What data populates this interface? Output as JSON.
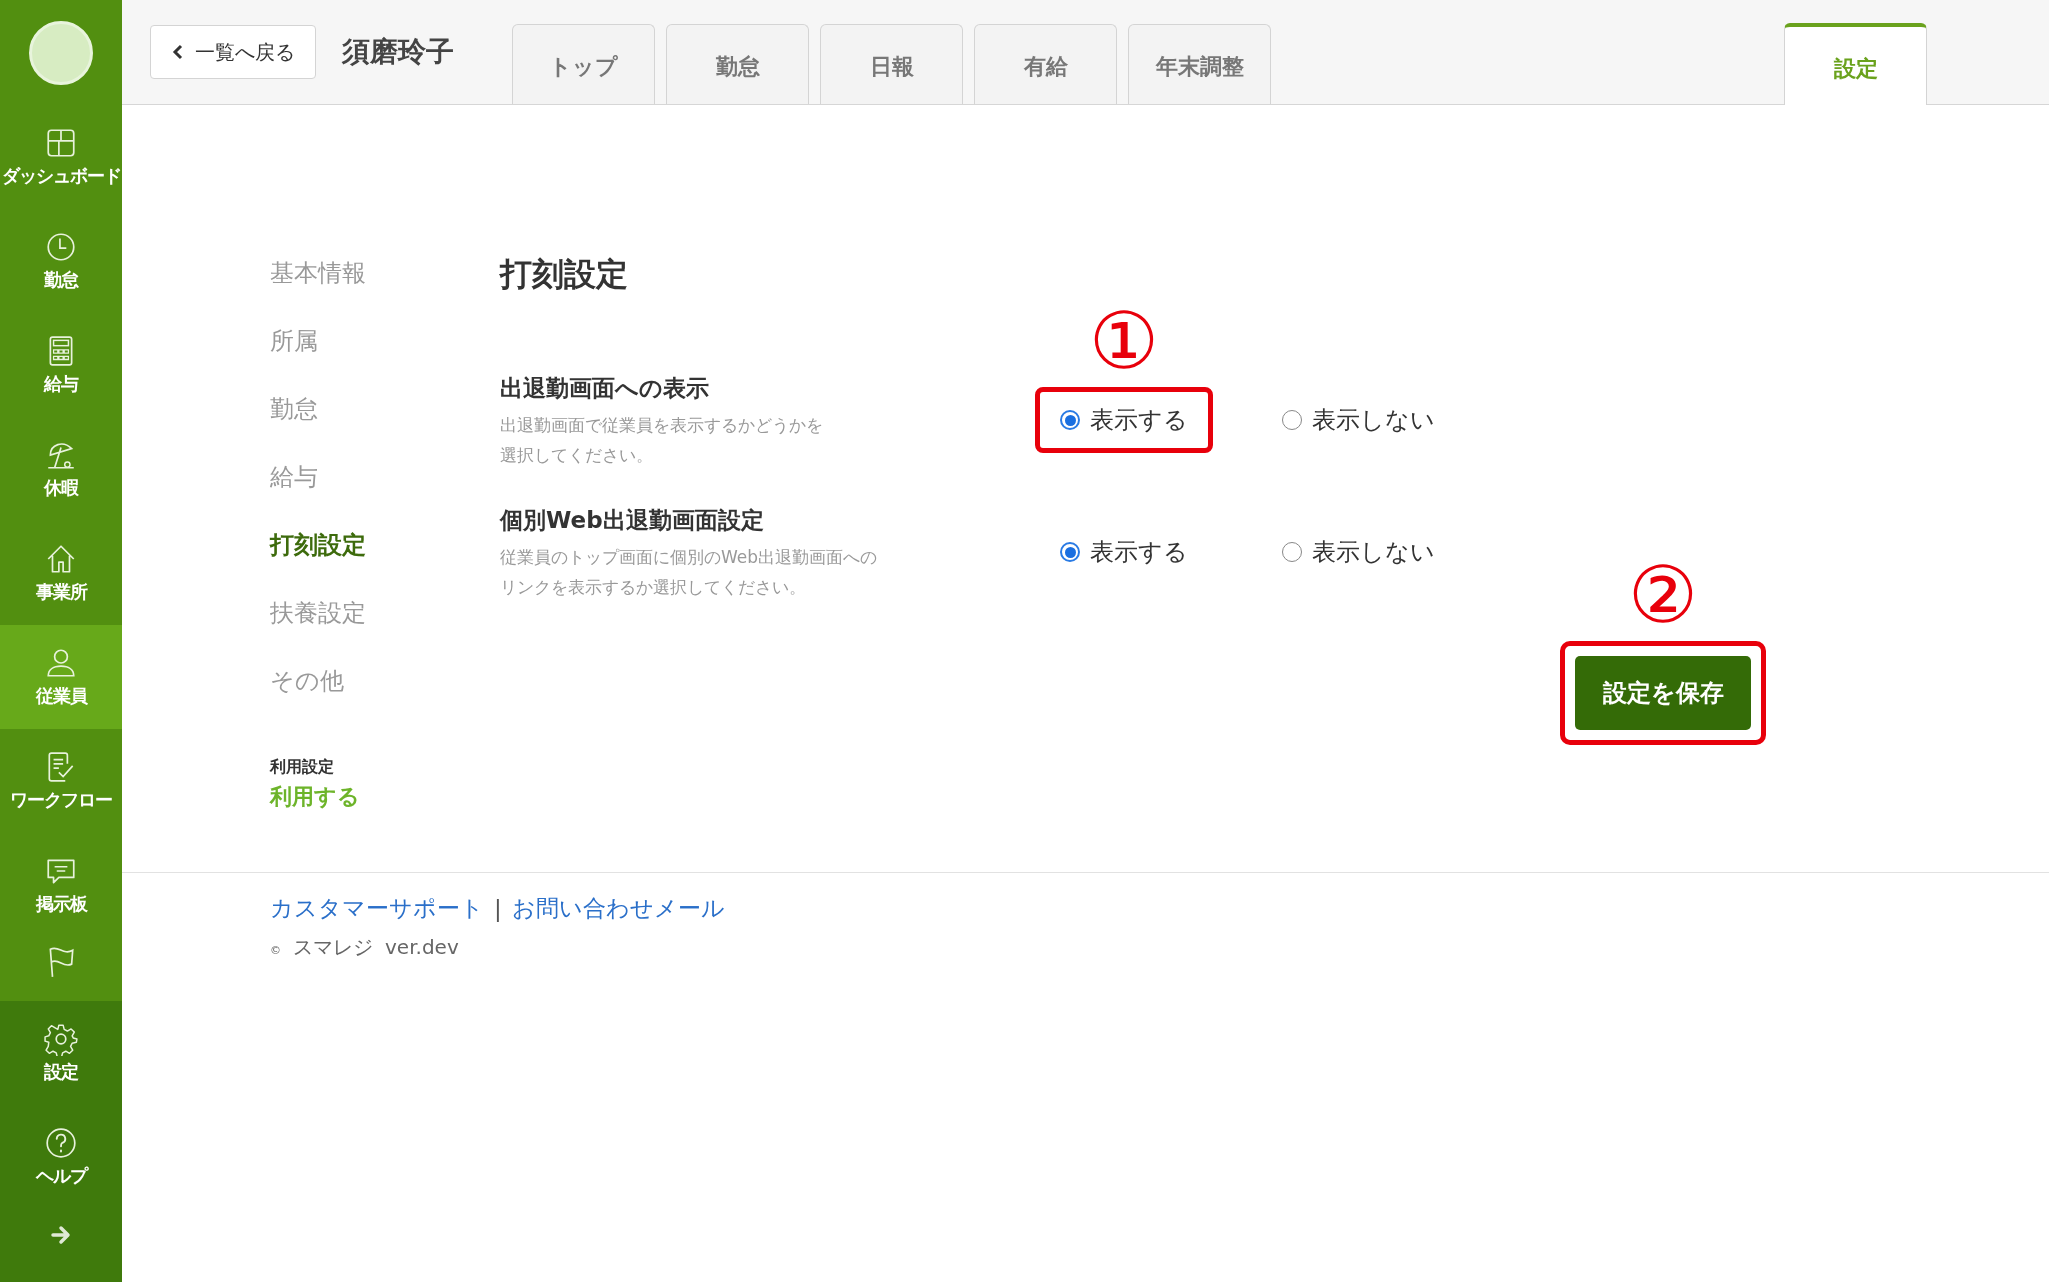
{
  "sidebar": {
    "items": [
      {
        "label": "ダッシュボード",
        "selected": false
      },
      {
        "label": "勤怠",
        "selected": false
      },
      {
        "label": "給与",
        "selected": false
      },
      {
        "label": "休暇",
        "selected": false
      },
      {
        "label": "事業所",
        "selected": false
      },
      {
        "label": "従業員",
        "selected": true
      },
      {
        "label": "ワークフロー",
        "selected": false
      },
      {
        "label": "掲示板",
        "selected": false
      }
    ],
    "flag_item": {
      "selected": false
    },
    "bottom_items": [
      {
        "label": "設定"
      },
      {
        "label": "ヘルプ"
      }
    ]
  },
  "header": {
    "back_button": "一覧へ戻る",
    "employee_name": "須磨玲子",
    "tabs": [
      {
        "label": "トップ",
        "selected": false
      },
      {
        "label": "勤怠",
        "selected": false
      },
      {
        "label": "日報",
        "selected": false
      },
      {
        "label": "有給",
        "selected": false
      },
      {
        "label": "年末調整",
        "selected": false
      }
    ],
    "right_tab": {
      "label": "設定",
      "selected": true
    }
  },
  "settings_nav": {
    "items": [
      {
        "label": "基本情報",
        "selected": false
      },
      {
        "label": "所属",
        "selected": false
      },
      {
        "label": "勤怠",
        "selected": false
      },
      {
        "label": "給与",
        "selected": false
      },
      {
        "label": "打刻設定",
        "selected": true
      },
      {
        "label": "扶養設定",
        "selected": false
      },
      {
        "label": "その他",
        "selected": false
      }
    ],
    "usage_label": "利用設定",
    "usage_value": "利用する"
  },
  "section": {
    "title": "打刻設定",
    "rows": [
      {
        "label": "出退勤画面への表示",
        "description_lines": [
          "出退勤画面で従業員を表示するかどうかを",
          "選択してください。"
        ],
        "options": [
          {
            "label": "表示する",
            "selected": true,
            "callout": "①"
          },
          {
            "label": "表示しない",
            "selected": false
          }
        ]
      },
      {
        "label": "個別Web出退勤画面設定",
        "description_lines": [
          "従業員のトップ画面に個別のWeb出退勤画面への",
          "リンクを表示するか選択してください。"
        ],
        "options": [
          {
            "label": "表示する",
            "selected": true
          },
          {
            "label": "表示しない",
            "selected": false
          }
        ]
      }
    ]
  },
  "save_button": {
    "label": "設定を保存",
    "callout": "②"
  },
  "footer": {
    "links": [
      "カスタマーサポート",
      "お問い合わせメール"
    ],
    "separator": "|",
    "copyright_mark": "©",
    "copyright": "スマレジ",
    "version": "ver.dev"
  }
}
